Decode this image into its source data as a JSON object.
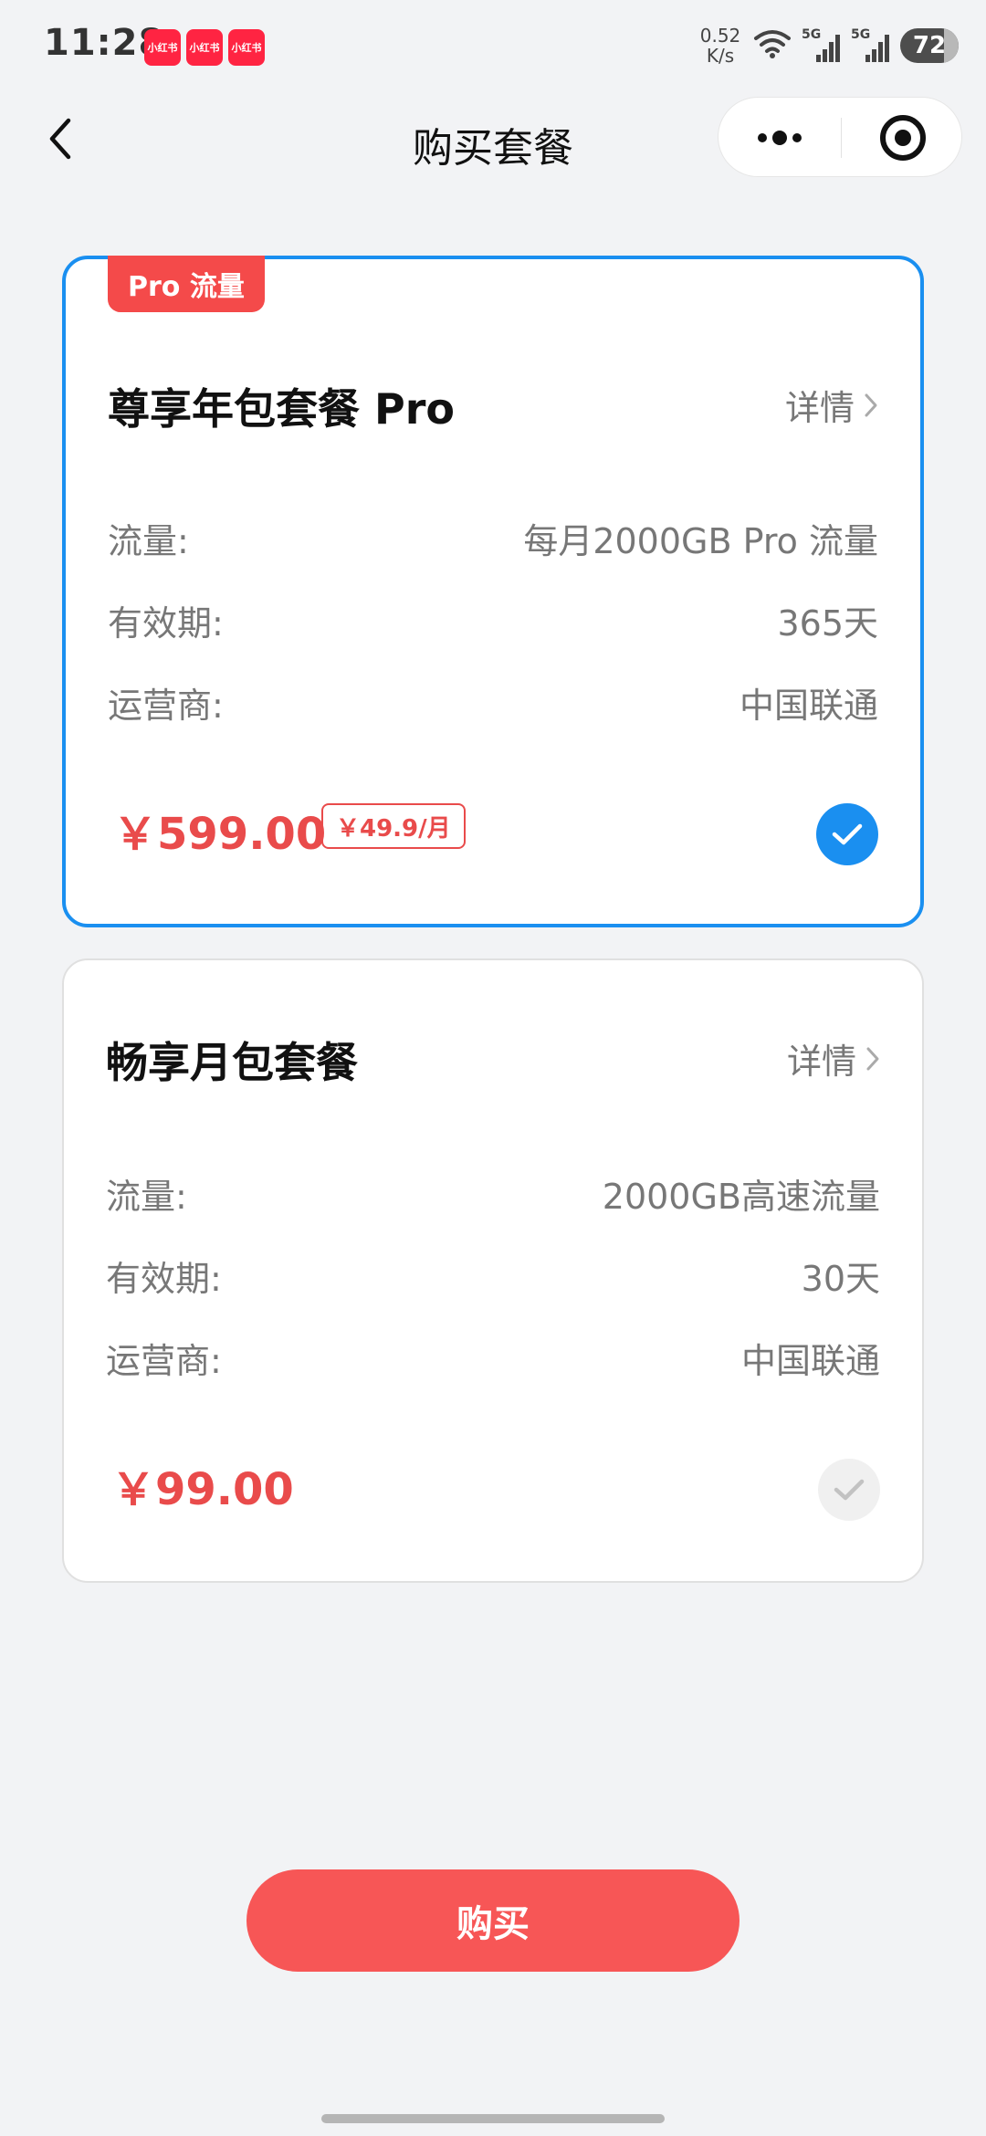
{
  "status_bar": {
    "time": "11:28",
    "app_badge_label": "小红书",
    "net_speed_value": "0.52",
    "net_speed_unit": "K/s",
    "signal_1_label": "5G",
    "signal_2_label": "5G",
    "battery": "72"
  },
  "nav": {
    "title": "购买套餐"
  },
  "plans": [
    {
      "badge": "Pro 流量",
      "title": "尊享年包套餐 Pro",
      "detail_label": "详情",
      "rows": [
        {
          "label": "流量:",
          "value": "每月2000GB Pro 流量"
        },
        {
          "label": "有效期:",
          "value": "365天"
        },
        {
          "label": "运营商:",
          "value": "中国联通"
        }
      ],
      "price": "￥599.00",
      "monthly_price": "￥49.9/月",
      "selected": true
    },
    {
      "title": "畅享月包套餐",
      "detail_label": "详情",
      "rows": [
        {
          "label": "流量:",
          "value": "2000GB高速流量"
        },
        {
          "label": "有效期:",
          "value": "30天"
        },
        {
          "label": "运营商:",
          "value": "中国联通"
        }
      ],
      "price": "￥99.00",
      "selected": false
    }
  ],
  "buy_label": "购买",
  "colors": {
    "accent_blue": "#1a8ff0",
    "price_red": "#e94b4b",
    "buy_button": "#f75656",
    "badge_red": "#f44a4a"
  }
}
